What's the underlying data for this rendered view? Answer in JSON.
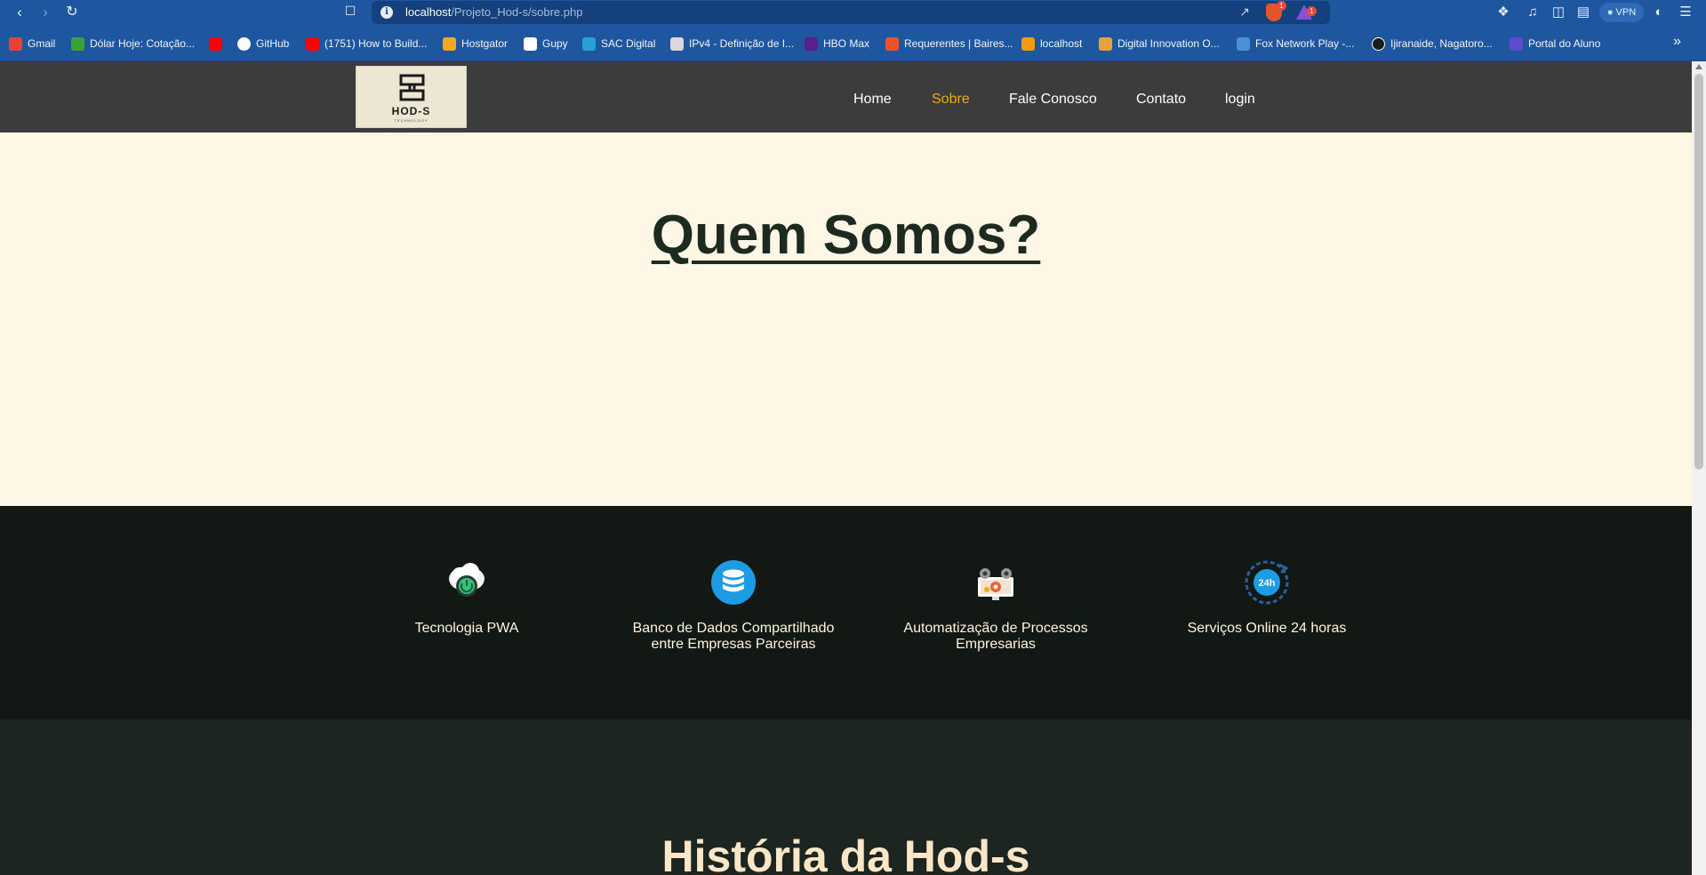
{
  "browser": {
    "url_host": "localhost",
    "url_path": "/Projeto_Hod-s/sobre.php",
    "shield_badge": "1",
    "rewards_badge": "1",
    "vpn_label": "VPN",
    "bookmarks": [
      {
        "label": "Gmail",
        "icon": "gmail-icon",
        "color": "#ea4335"
      },
      {
        "label": "Dólar Hoje: Cotação...",
        "icon": "dollar-icon",
        "color": "#3aa335"
      },
      {
        "label": "",
        "icon": "youtube-icon",
        "color": "#ff0000"
      },
      {
        "label": "GitHub",
        "icon": "github-icon",
        "color": "#ffffff"
      },
      {
        "label": "(1751) How to Build...",
        "icon": "youtube-icon",
        "color": "#ff0000"
      },
      {
        "label": "Hostgator",
        "icon": "hostgator-icon",
        "color": "#f5a623"
      },
      {
        "label": "Gupy",
        "icon": "gupy-icon",
        "color": "#ffffff"
      },
      {
        "label": "SAC Digital",
        "icon": "sac-icon",
        "color": "#27a0d8"
      },
      {
        "label": "IPv4 - Definição de I...",
        "icon": "ipv4-icon",
        "color": "#d9d9d9"
      },
      {
        "label": "HBO Max",
        "icon": "hbomax-icon",
        "color": "#5b1f8c"
      },
      {
        "label": "Requerentes | Baires...",
        "icon": "baires-icon",
        "color": "#f0522b"
      },
      {
        "label": "localhost",
        "icon": "localhost-icon",
        "color": "#f39c12"
      },
      {
        "label": "Digital Innovation O...",
        "icon": "dio-icon",
        "color": "#e7a23a"
      },
      {
        "label": "Fox Network Play -...",
        "icon": "fox-icon",
        "color": "#4a90d9"
      },
      {
        "label": "Ijiranaide, Nagatoro...",
        "icon": "anilist-icon",
        "color": "#1b1b1b"
      },
      {
        "label": "Portal do Aluno",
        "icon": "portal-icon",
        "color": "#5a4bd1"
      }
    ]
  },
  "site": {
    "logo": {
      "name": "HOD-S",
      "sub": "TECHNOLOGY"
    },
    "nav": [
      {
        "label": "Home",
        "active": false
      },
      {
        "label": "Sobre",
        "active": true
      },
      {
        "label": "Fale Conosco",
        "active": false
      },
      {
        "label": "Contato",
        "active": false
      },
      {
        "label": "login",
        "active": false
      }
    ],
    "hero_title": "Quem Somos?",
    "features": [
      {
        "label": "Tecnologia PWA",
        "icon": "cloud-power-icon"
      },
      {
        "label": "Banco de Dados Compartilhado entre Empresas Parceiras",
        "icon": "database-icon"
      },
      {
        "label": "Automatização de Processos Empresarias",
        "icon": "automation-gears-icon"
      },
      {
        "label": "Serviços Online 24 horas",
        "icon": "clock-24h-icon",
        "icon_text": "24h"
      }
    ],
    "history_title": "História da Hod-s"
  },
  "colors": {
    "browser_blue": "#1e56a0",
    "header_bg": "#3c3c3c",
    "nav_active": "#f0a91b",
    "hero_bg": "#fff7e6",
    "features_bg": "#121813",
    "history_bg": "#1c251f"
  }
}
